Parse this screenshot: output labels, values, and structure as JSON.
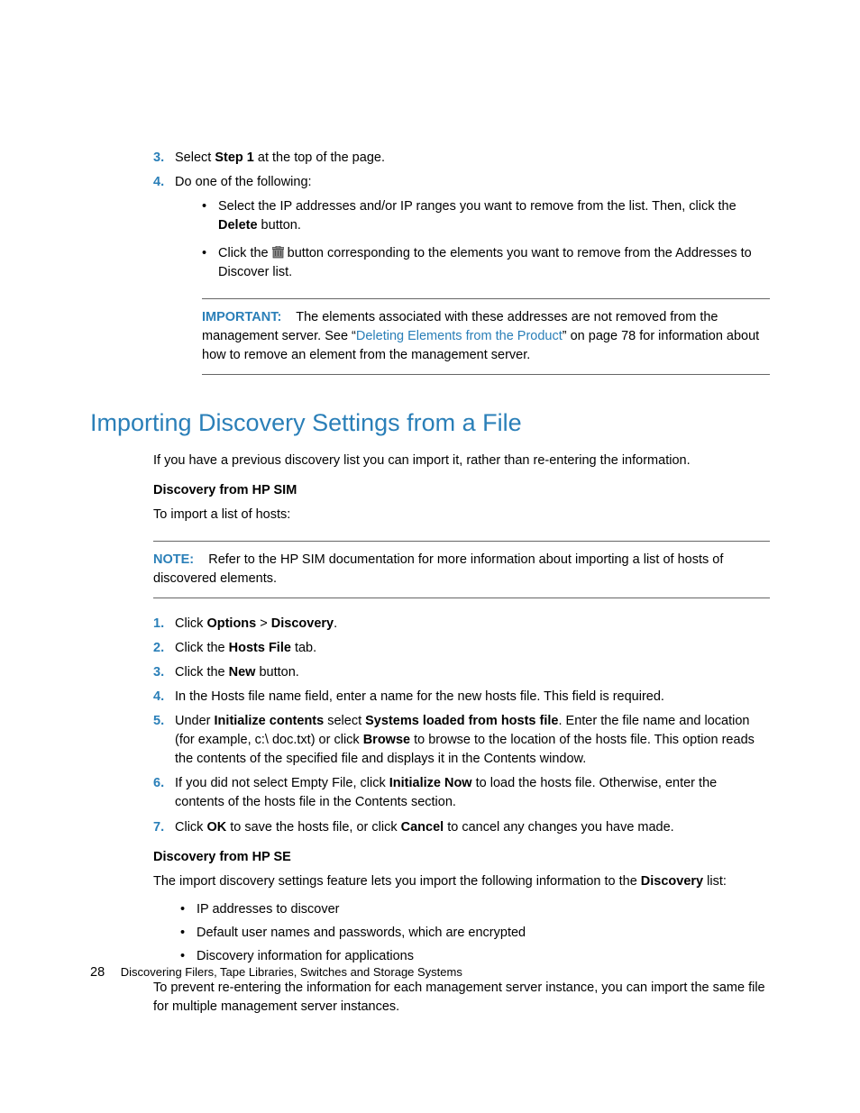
{
  "top_list": {
    "item3": {
      "num": "3.",
      "pre": "Select ",
      "bold": "Step 1",
      "post": " at the top of the page."
    },
    "item4": {
      "num": "4.",
      "text": "Do one of the following:",
      "sub1": {
        "pre": "Select the IP addresses and/or IP ranges you want to remove from the list. Then, click the ",
        "bold": "Delete",
        "post": " button."
      },
      "sub2": {
        "pre": "Click the ",
        "post": " button corresponding to the elements you want to remove from the Addresses to Discover list."
      }
    }
  },
  "important": {
    "label": "IMPORTANT:",
    "pre": "The elements associated with these addresses are not removed from the management server. See “",
    "link": "Deleting Elements from the Product",
    "post": "” on page 78 for information about how to remove an element from the management server."
  },
  "section": {
    "heading": "Importing Discovery Settings from a File",
    "intro": "If you have a previous discovery list you can import it, rather than re-entering the information.",
    "sim_heading": "Discovery from HP SIM",
    "sim_intro": "To import a list of hosts:"
  },
  "note": {
    "label": "NOTE:",
    "text": "Refer to the HP SIM documentation for more information about importing a list of hosts of discovered elements."
  },
  "steps": {
    "s1": {
      "num": "1.",
      "pre": "Click ",
      "b1": "Options",
      "mid": " > ",
      "b2": "Discovery",
      "post": "."
    },
    "s2": {
      "num": "2.",
      "pre": "Click the ",
      "b1": "Hosts File",
      "post": " tab."
    },
    "s3": {
      "num": "3.",
      "pre": "Click the ",
      "b1": "New",
      "post": " button."
    },
    "s4": {
      "num": "4.",
      "text": "In the Hosts file name field, enter a name for the new hosts file. This field is required."
    },
    "s5": {
      "num": "5.",
      "pre": "Under ",
      "b1": "Initialize contents",
      "mid1": " select ",
      "b2": "Systems loaded from hosts file",
      "mid2": ". Enter the file name and location (for example, c:\\ doc.txt) or click ",
      "b3": "Browse",
      "post": " to browse to the location of the hosts file. This option reads the contents of the specified file and displays it in the Contents window."
    },
    "s6": {
      "num": "6.",
      "pre": "If you did not select Empty File, click ",
      "b1": "Initialize Now",
      "post": " to load the hosts file. Otherwise, enter the contents of the hosts file in the Contents section."
    },
    "s7": {
      "num": "7.",
      "pre": "Click ",
      "b1": "OK",
      "mid": " to save the hosts file, or click ",
      "b2": "Cancel",
      "post": " to cancel any changes you have made."
    }
  },
  "se": {
    "heading": "Discovery from HP SE",
    "intro_pre": "The import discovery settings feature lets you import the following information to the ",
    "intro_bold": "Discovery",
    "intro_post": " list:",
    "b1": "IP addresses to discover",
    "b2": "Default user names and passwords, which are encrypted",
    "b3": "Discovery information for applications",
    "outro": "To prevent re-entering the information for each management server instance, you can import the same file for multiple management server instances."
  },
  "footer": {
    "page": "28",
    "chapter": "Discovering Filers, Tape Libraries, Switches and Storage Systems"
  }
}
